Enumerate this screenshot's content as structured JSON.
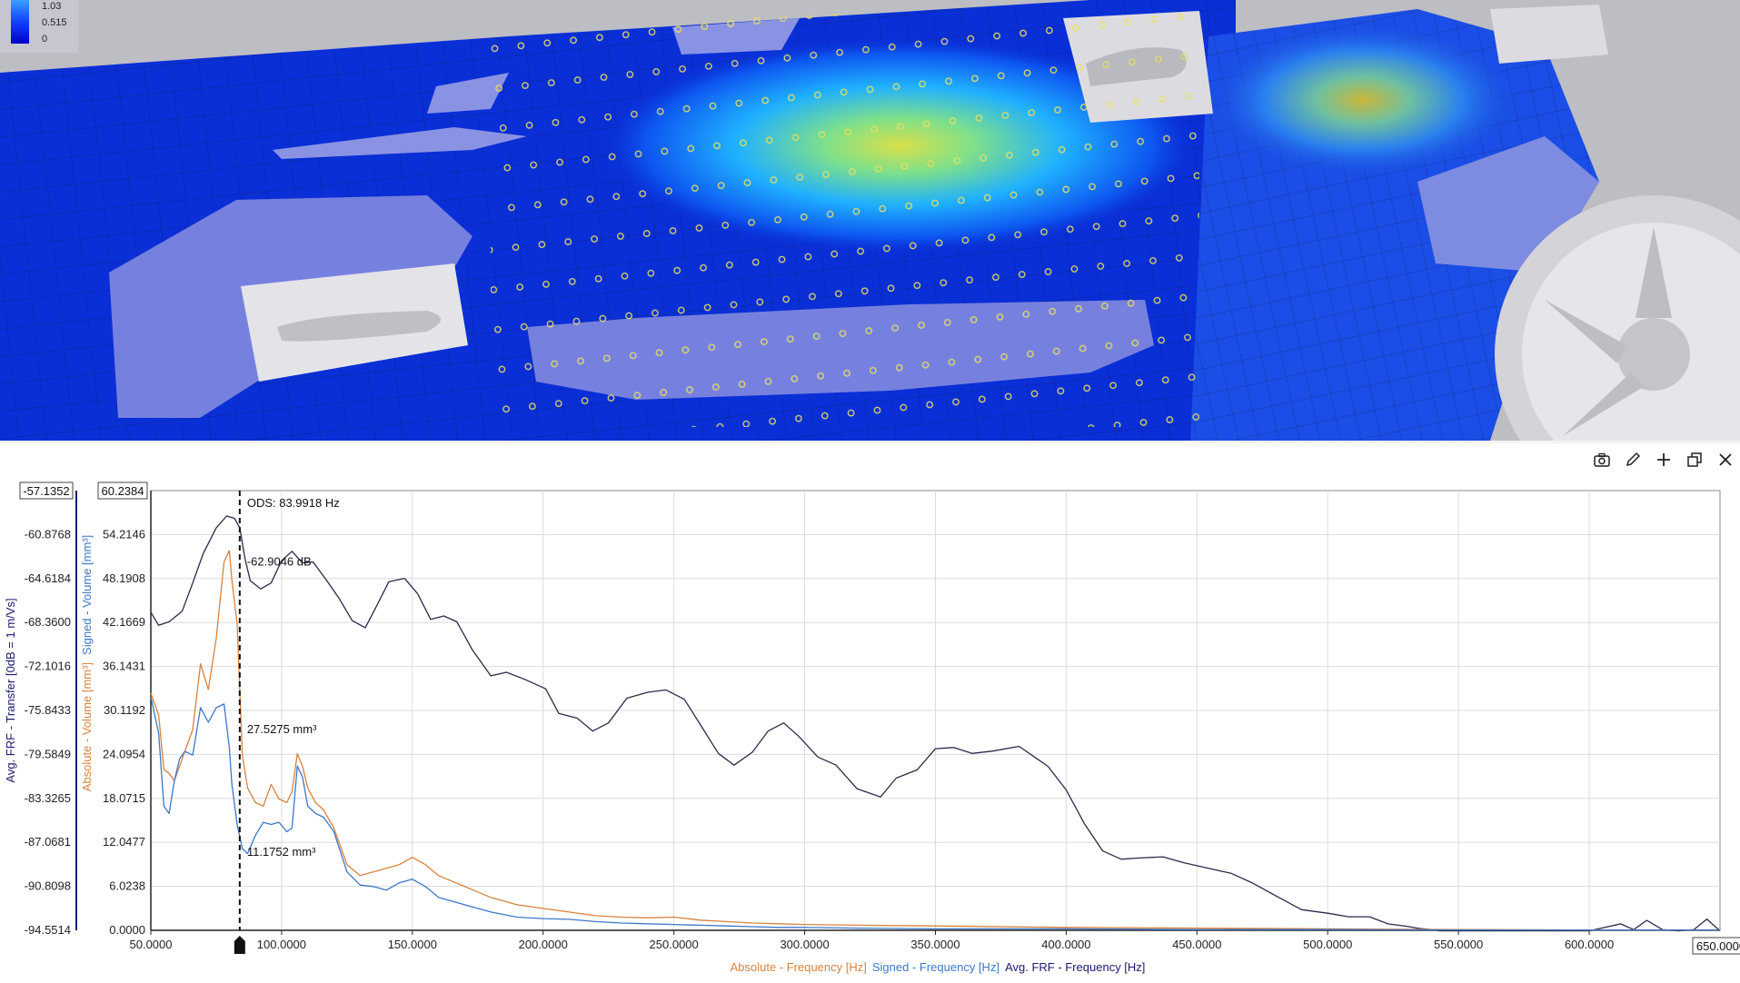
{
  "colors": {
    "panel_blue": "#0a2fd6",
    "mesh_gray": "#c8c8cc",
    "frf_curve": "#2a2a4a",
    "absolute_curve": "#d9823b",
    "signed_curve": "#3c78c8",
    "axis_frf": "#1a1a70",
    "axis_absolute": "#d9823b",
    "axis_signed": "#3c78c8"
  },
  "legend": {
    "max_value": "1.03",
    "mid_value": "0.515",
    "min_value": "0"
  },
  "toolbar": {
    "items": [
      "camera-icon",
      "pencil-icon",
      "plus-icon",
      "restore-window-icon",
      "close-icon"
    ]
  },
  "chart_data": {
    "type": "line",
    "title": "",
    "x_range": [
      50,
      650
    ],
    "x_ticks": [
      "50.0000",
      "100.0000",
      "150.0000",
      "200.0000",
      "250.0000",
      "300.0000",
      "350.0000",
      "400.0000",
      "450.0000",
      "500.0000",
      "550.0000",
      "600.0000"
    ],
    "x_max_box": "650.0000",
    "left_axis": {
      "label_parts": [
        "Avg. FRF",
        " - ",
        "Transfer [0dB = 1 m/Vs]"
      ],
      "range": [
        -94.5514,
        -57.1352
      ],
      "top_box": "-57.1352",
      "ticks": [
        "-60.8768",
        "-64.6184",
        "-68.3600",
        "-72.1016",
        "-75.8433",
        "-79.5849",
        "-83.3265",
        "-87.0681",
        "-90.8098",
        "-94.5514"
      ]
    },
    "right_axis": {
      "label_abs": "Absolute - Volume [mm³]",
      "label_signed": "Signed - Volume [mm³]",
      "range": [
        0,
        60.2384
      ],
      "top_box": "60.2384",
      "ticks": [
        "54.2146",
        "48.1908",
        "42.1669",
        "36.1431",
        "30.1192",
        "24.0954",
        "18.0715",
        "12.0477",
        "6.0238",
        "0.0000"
      ]
    },
    "x_legend": {
      "absolute": "Absolute - Frequency [Hz]",
      "signed": "Signed - Frequency [Hz]",
      "frf": "Avg. FRF - Frequency [Hz]"
    },
    "cursor": {
      "label": "ODS: 83.9918 Hz",
      "x": 83.9918,
      "frf_readout": "-62.9046 dB",
      "abs_readout": "27.5275 mm³",
      "signed_readout": "11.1752 mm³"
    },
    "series": [
      {
        "name": "Avg. FRF",
        "axis": "left",
        "x": [
          50,
          53,
          57,
          62,
          66,
          70,
          75,
          79,
          82,
          84,
          86,
          88,
          92,
          96,
          100,
          104,
          108,
          112,
          117,
          122,
          127,
          132,
          136,
          141,
          147,
          152,
          157,
          162,
          167,
          173,
          180,
          186,
          193,
          201,
          206,
          213,
          219,
          225,
          232,
          240,
          247,
          254,
          260,
          267,
          273,
          280,
          286,
          292,
          298,
          305,
          312,
          320,
          329,
          335,
          343,
          350,
          357,
          364,
          372,
          382,
          393,
          400,
          407,
          414,
          421,
          428,
          437,
          445,
          455,
          463,
          471,
          480,
          490,
          500,
          508,
          516,
          523,
          530,
          535,
          540,
          543,
          545,
          548,
          552,
          600,
          612,
          617,
          622,
          628,
          634,
          640,
          645,
          648,
          650
        ],
        "y": [
          -67.5,
          -68.6,
          -68.3,
          -67.4,
          -65.0,
          -62.5,
          -60.3,
          -59.3,
          -59.5,
          -60.3,
          -62.9,
          -64.8,
          -65.5,
          -65.0,
          -63.1,
          -62.3,
          -63.3,
          -63.2,
          -64.7,
          -66.3,
          -68.2,
          -68.8,
          -67.1,
          -64.9,
          -64.6,
          -65.9,
          -68.1,
          -67.8,
          -68.3,
          -70.7,
          -72.9,
          -72.6,
          -73.2,
          -74.0,
          -76.1,
          -76.5,
          -77.6,
          -76.9,
          -74.8,
          -74.3,
          -74.1,
          -74.9,
          -77.0,
          -79.5,
          -80.5,
          -79.4,
          -77.6,
          -76.9,
          -78.1,
          -79.8,
          -80.5,
          -82.5,
          -83.2,
          -81.6,
          -80.9,
          -79.1,
          -79.0,
          -79.5,
          -79.3,
          -78.9,
          -80.6,
          -82.6,
          -85.5,
          -87.8,
          -88.5,
          -88.4,
          -88.3,
          -88.8,
          -89.3,
          -89.7,
          -90.5,
          -91.6,
          -92.8,
          -93.1,
          -93.4,
          -93.4,
          -94.0,
          -94.2,
          -94.4,
          -94.5,
          -94.6,
          -94.6,
          -94.6,
          -94.6,
          -94.6,
          -94.0,
          -94.5,
          -93.7,
          -94.5,
          -94.6,
          -94.5,
          -93.6,
          -94.2,
          -94.6
        ]
      },
      {
        "name": "Absolute",
        "axis": "right",
        "x": [
          50,
          53,
          55,
          57,
          59,
          61,
          63,
          66,
          69,
          72,
          75,
          78,
          80,
          81,
          83,
          85,
          87,
          90,
          93,
          96,
          99,
          102,
          104,
          106,
          108,
          110,
          113,
          116,
          120,
          125,
          130,
          135,
          140,
          145,
          150,
          155,
          160,
          170,
          180,
          190,
          200,
          210,
          220,
          230,
          240,
          250,
          260,
          270,
          280,
          290,
          300,
          320,
          350,
          400,
          450,
          500,
          550,
          600,
          650
        ],
        "y": [
          32.5,
          29.5,
          22.0,
          21.5,
          20.5,
          22.5,
          24.5,
          27.5,
          36.5,
          33.0,
          40.0,
          50.5,
          52.0,
          48.0,
          42.0,
          24.0,
          19.5,
          17.5,
          17.0,
          20.0,
          18.0,
          17.5,
          19.0,
          24.2,
          22.5,
          19.5,
          17.5,
          16.5,
          14.0,
          9.0,
          7.5,
          8.0,
          8.5,
          9.0,
          10.0,
          9.0,
          7.5,
          6.0,
          4.5,
          3.5,
          3.0,
          2.5,
          2.0,
          1.8,
          1.7,
          1.8,
          1.4,
          1.2,
          1.0,
          0.9,
          0.8,
          0.7,
          0.6,
          0.4,
          0.3,
          0.2,
          0.1,
          0.05,
          0.05
        ]
      },
      {
        "name": "Signed",
        "axis": "right",
        "x": [
          50,
          53,
          55,
          57,
          59,
          61,
          63,
          66,
          69,
          72,
          75,
          78,
          80,
          81,
          83,
          85,
          87,
          90,
          93,
          96,
          99,
          102,
          104,
          106,
          108,
          110,
          113,
          116,
          120,
          125,
          130,
          135,
          140,
          145,
          150,
          155,
          160,
          170,
          180,
          190,
          200,
          210,
          220,
          230,
          240,
          250,
          260,
          270,
          280,
          290,
          300,
          320,
          350,
          400,
          450,
          500,
          550,
          600,
          650
        ],
        "y": [
          32.0,
          27.0,
          17.0,
          16.0,
          20.5,
          23.5,
          24.5,
          24.0,
          30.5,
          28.5,
          30.5,
          31.0,
          25.0,
          20.0,
          14.5,
          11.2,
          10.5,
          13.0,
          14.8,
          14.5,
          14.8,
          13.5,
          14.0,
          22.5,
          21.0,
          17.0,
          16.0,
          15.5,
          13.5,
          8.0,
          6.2,
          6.0,
          5.5,
          6.5,
          7.0,
          6.0,
          4.5,
          3.5,
          2.5,
          1.8,
          1.6,
          1.5,
          1.2,
          1.0,
          0.9,
          0.8,
          0.7,
          0.6,
          0.5,
          0.4,
          0.4,
          0.3,
          0.2,
          0.2,
          0.1,
          0.1,
          0.05,
          0.05,
          0.05
        ]
      }
    ]
  }
}
